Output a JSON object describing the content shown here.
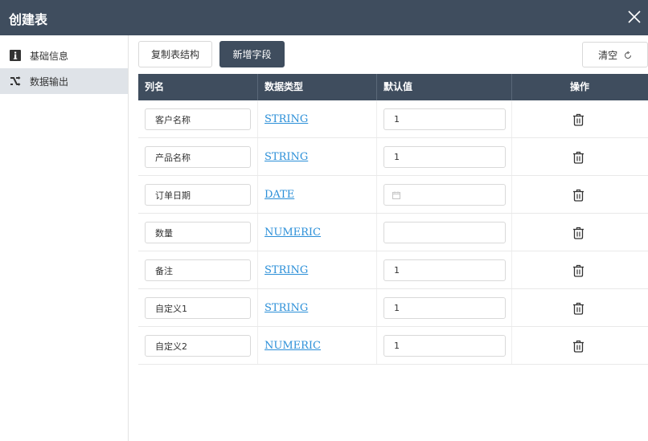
{
  "window": {
    "title": "创建表",
    "close_icon": "close-icon"
  },
  "sidebar": {
    "items": [
      {
        "label": "基础信息",
        "icon": "info-icon",
        "active": false
      },
      {
        "label": "数据输出",
        "icon": "shuffle-icon",
        "active": true
      }
    ]
  },
  "toolbar": {
    "copy_label": "复制表结构",
    "add_label": "新增字段",
    "clear_label": "清空",
    "clear_icon": "refresh-icon"
  },
  "table": {
    "headers": [
      "列名",
      "数据类型",
      "默认值",
      "操作"
    ],
    "rows": [
      {
        "name": "客户名称",
        "type": "STRING",
        "default": "1"
      },
      {
        "name": "产品名称",
        "type": "STRING",
        "default": "1"
      },
      {
        "name": "订单日期",
        "type": "DATE",
        "default": ""
      },
      {
        "name": "数量",
        "type": "NUMERIC",
        "default": ""
      },
      {
        "name": "备注",
        "type": "STRING",
        "default": "1"
      },
      {
        "name": "自定义1",
        "type": "STRING",
        "default": "1"
      },
      {
        "name": "自定义2",
        "type": "NUMERIC",
        "default": "1"
      }
    ]
  },
  "colors": {
    "header_bg": "#3f4d5e",
    "link": "#2b8fd8",
    "sidebar_active": "#dfe3e8"
  }
}
